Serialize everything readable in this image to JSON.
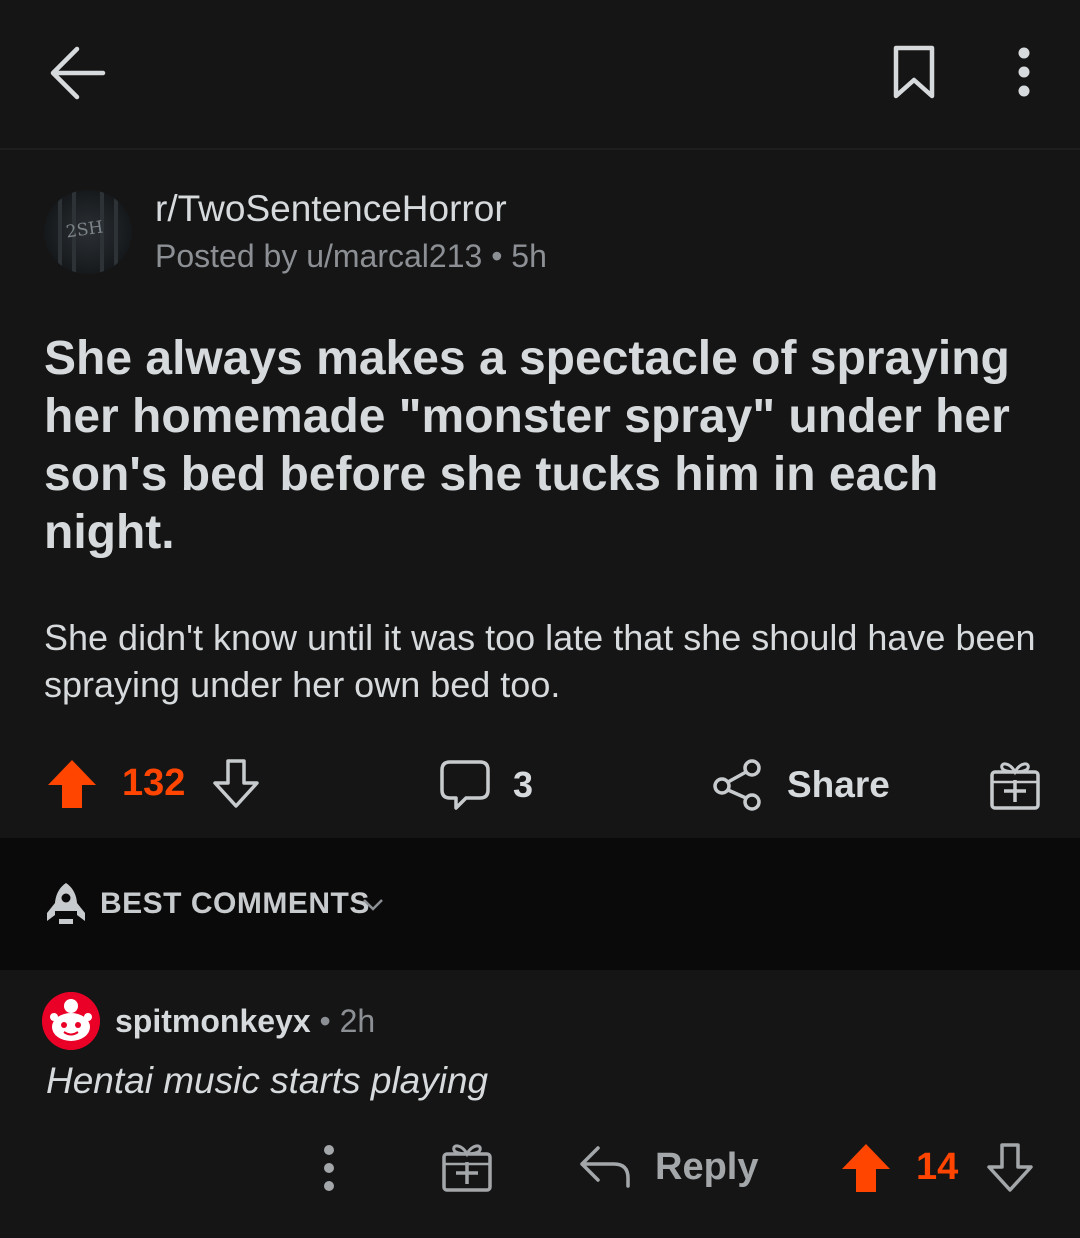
{
  "header": {
    "back_icon": "arrow-left-icon",
    "save_icon": "bookmark-icon",
    "more_icon": "more-vertical-icon"
  },
  "post": {
    "subreddit": "r/TwoSentenceHorror",
    "subreddit_avatar_text": "2SH",
    "posted_by": "Posted by u/marcal213 • 5h",
    "title": "She always makes a spectacle of spraying her homemade \"monster spray\" under her son's bed before she tucks him in each night.",
    "body": "She didn't know until it was too late that she should have been spraying under her own bed too.",
    "votes": "132",
    "comments": "3",
    "share_label": "Share",
    "upvote_color": "#ff4500"
  },
  "sort": {
    "label": "BEST COMMENTS"
  },
  "comment": {
    "username": "spitmonkeyx",
    "age": " • 2h",
    "body": "Hentai music starts playing",
    "reply_label": "Reply",
    "votes": "14"
  }
}
